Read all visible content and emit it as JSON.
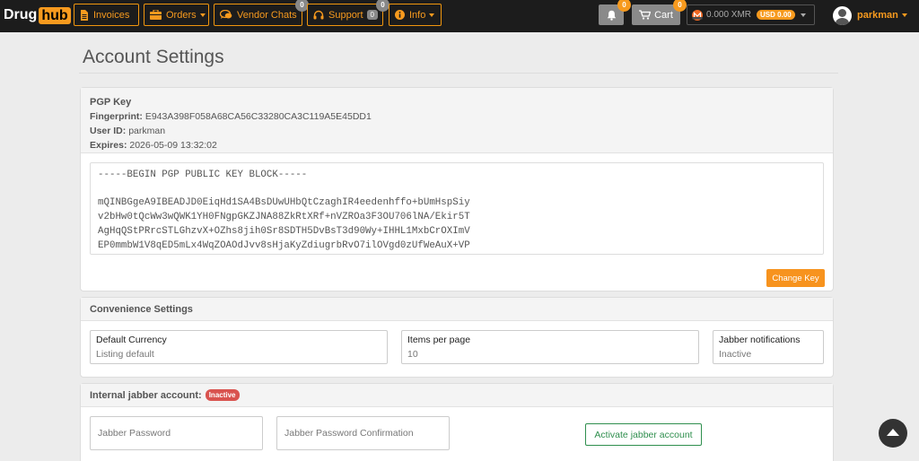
{
  "logo": {
    "part1": "Drug",
    "part2": "hub"
  },
  "nav": {
    "invoices": "Invoices",
    "orders": "Orders",
    "vendor_chats": "Vendor Chats",
    "vendor_chats_badge": "0",
    "support": "Support",
    "support_inline_badge": "0",
    "support_badge": "0",
    "info": "Info",
    "notifications_badge": "0",
    "cart": "Cart",
    "cart_badge": "0",
    "wallet_amount": "0.000 XMR",
    "wallet_usd": "USD 0.00",
    "username": "parkman"
  },
  "page": {
    "title": "Account Settings"
  },
  "pgp": {
    "title": "PGP Key",
    "fingerprint_label": "Fingerprint:",
    "fingerprint": "E943A398F058A68CA56C33280CA3C119A5E45DD1",
    "userid_label": "User ID:",
    "userid": "parkman",
    "expires_label": "Expires:",
    "expires": "2026-05-09 13:32:02",
    "key_text": "-----BEGIN PGP PUBLIC KEY BLOCK-----\n\nmQINBGgeA9IBEADJD0EiqHd1SA4BsDUwUHbQtCzaghIR4eedenhffo+bUmHspSiy\nv2bHw0tQcWw3wQWK1YH0FNgpGKZJNA88ZkRtXRf+nVZROa3F3OU706lNA/Ekir5T\nAgHqQStPRrcSTLGhzvX+OZhs8jih0Sr8SDTH5DvBsT3d90Wy+IHHL1MxbCrOXImV\nEP0mmbW1V8qED5mLx4WqZOAOdJvv8sHjaKyZdiugrbRvO7ilOVgd0zUfWeAuX+VP",
    "change_key": "Change Key"
  },
  "convenience": {
    "title": "Convenience Settings",
    "default_currency_label": "Default Currency",
    "default_currency_value": "Listing default",
    "items_per_page_label": "Items per page",
    "items_per_page_value": "10",
    "jabber_notifications_label": "Jabber notifications",
    "jabber_notifications_value": "Inactive"
  },
  "jabber": {
    "title": "Internal jabber account:",
    "status": "Inactive",
    "password_placeholder": "Jabber Password",
    "password_confirm_placeholder": "Jabber Password Confirmation",
    "activate": "Activate jabber account"
  },
  "colors": {
    "accent": "#f79a1e",
    "navbar": "#1c1c1c",
    "success": "#2f8f4e",
    "danger": "#d9534f"
  }
}
